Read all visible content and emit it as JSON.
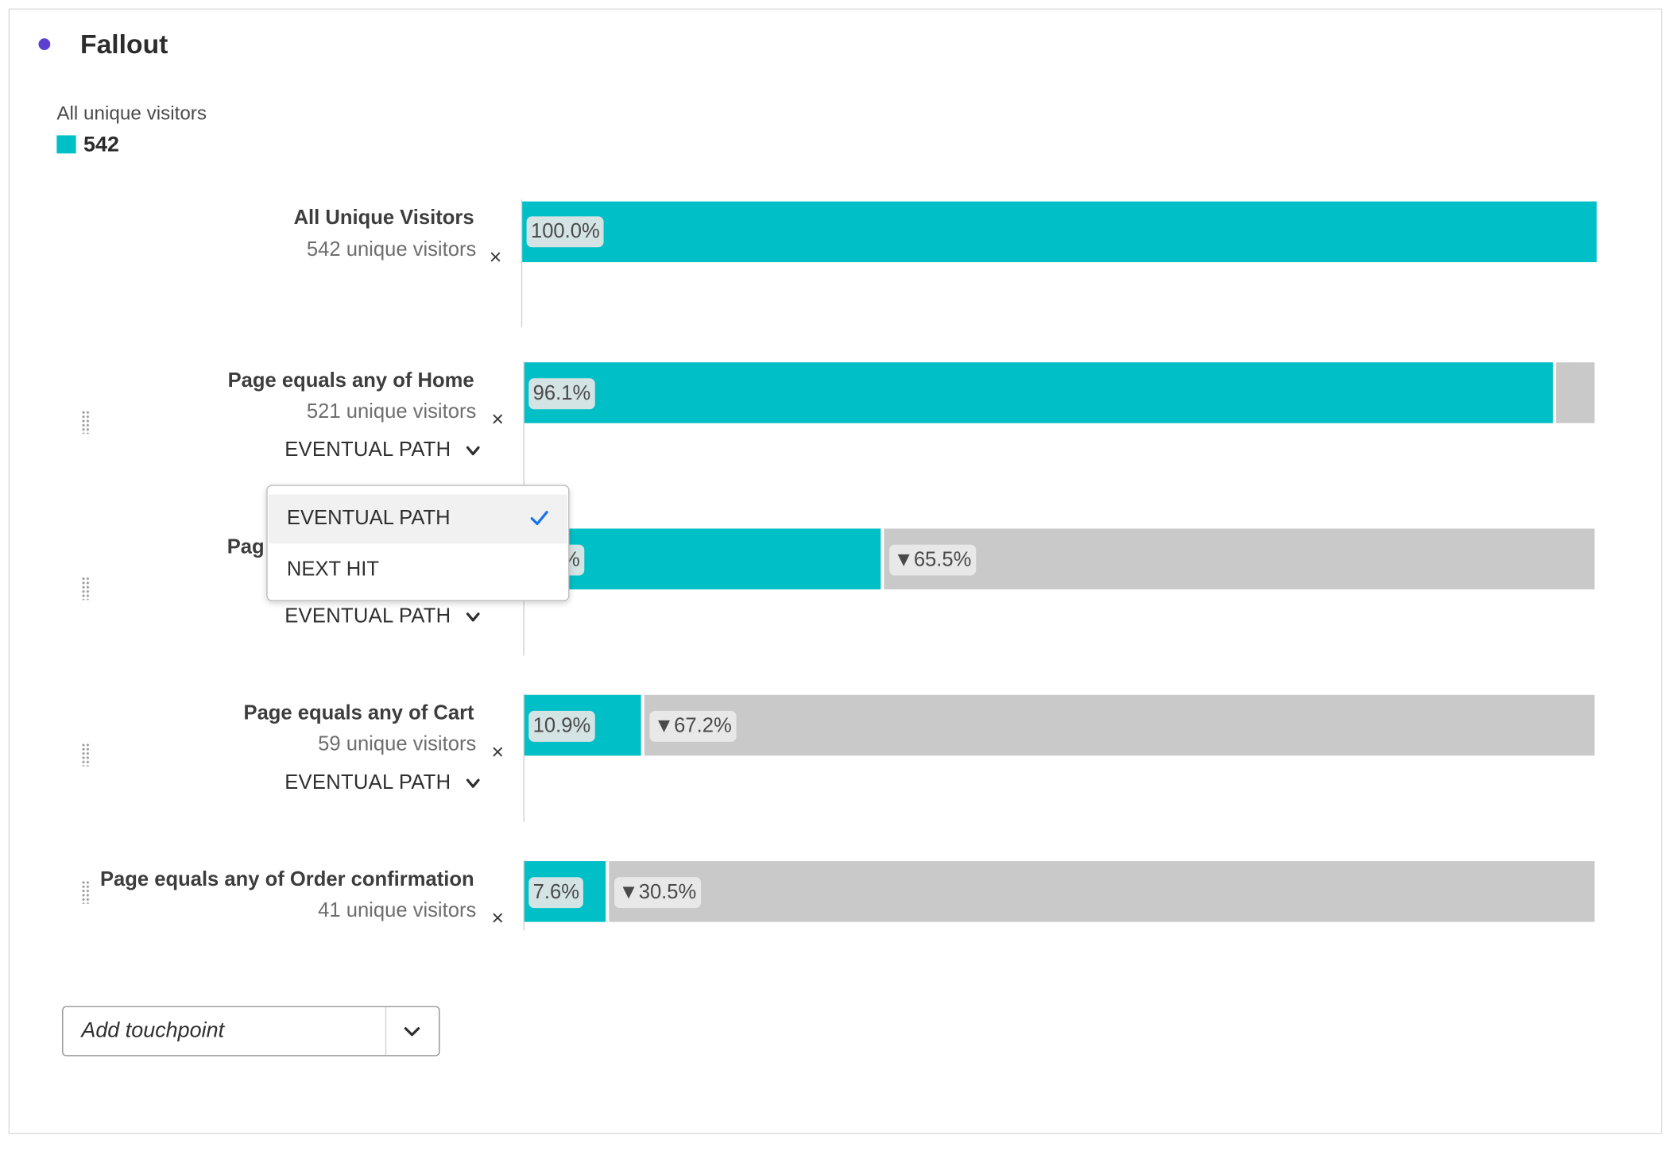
{
  "panel": {
    "title": "Fallout"
  },
  "legend": {
    "label": "All unique visitors",
    "value": "542",
    "color": "#00bfc6"
  },
  "colors": {
    "bar": "#00bfc6",
    "fallout": "#c9c9c9",
    "dot": "#5c3fd0",
    "check": "#1a73e8"
  },
  "steps": [
    {
      "name": "All Unique Visitors",
      "count": "542 unique visitors",
      "percent": "100.0%",
      "fallout": "",
      "path": ""
    },
    {
      "name": "Page equals any of Home",
      "count": "521 unique visitors",
      "percent": "96.1%",
      "fallout": "",
      "path": "EVENTUAL PATH"
    },
    {
      "name": "Pag",
      "count": "",
      "percent": "%",
      "fallout": "▼65.5%",
      "path": "EVENTUAL PATH"
    },
    {
      "name": "Page equals any of Cart",
      "count": "59 unique visitors",
      "percent": "10.9%",
      "fallout": "▼67.2%",
      "path": "EVENTUAL PATH"
    },
    {
      "name": "Page equals any of Order confirmation",
      "count": "41 unique visitors",
      "percent": "7.6%",
      "fallout": "▼30.5%",
      "path": ""
    }
  ],
  "icons": {
    "remove": "×",
    "chevron": "chevron-down-icon",
    "check": "checkmark-icon",
    "handle": "drag-handle-icon"
  },
  "dropdown": {
    "options": [
      {
        "label": "EVENTUAL PATH",
        "selected": true
      },
      {
        "label": "NEXT HIT",
        "selected": false
      }
    ]
  },
  "add_touchpoint": {
    "placeholder": "Add touchpoint"
  },
  "chart_data": {
    "type": "bar",
    "categories": [
      "All Unique Visitors",
      "Page equals any of Home",
      "Page equals any of Product",
      "Page equals any of Cart",
      "Page equals any of Order confirmation"
    ],
    "values": [
      100.0,
      96.1,
      33.3,
      10.9,
      7.6
    ],
    "fallout": [
      null,
      null,
      65.5,
      67.2,
      30.5
    ],
    "counts": [
      542,
      521,
      null,
      59,
      41
    ],
    "orientation": "horizontal",
    "xlim": [
      0,
      100
    ]
  }
}
